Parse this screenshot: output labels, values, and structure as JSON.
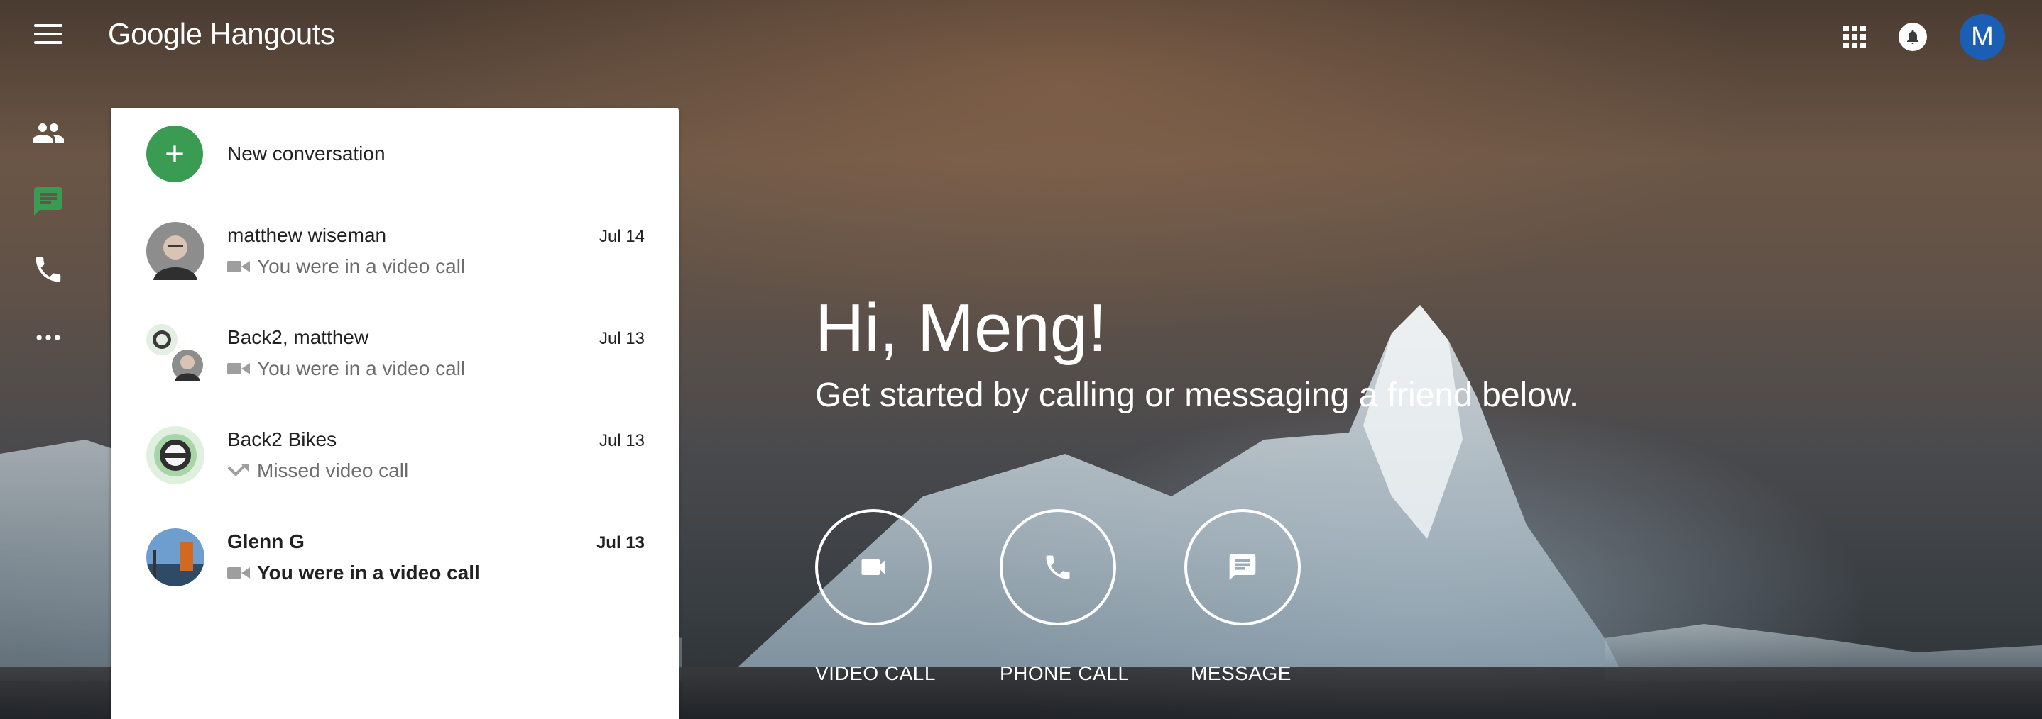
{
  "header": {
    "logo_google": "Google",
    "logo_product": "Hangouts",
    "account_initial": "M",
    "icons": [
      "menu-icon",
      "apps-grid-icon",
      "notifications-bell-icon"
    ]
  },
  "rail": {
    "items": [
      {
        "name": "contacts",
        "icon": "people-icon"
      },
      {
        "name": "conversations",
        "icon": "chat-icon",
        "active": true
      },
      {
        "name": "phone-calls",
        "icon": "phone-icon"
      },
      {
        "name": "more",
        "icon": "more-horiz-icon"
      }
    ]
  },
  "panel": {
    "new_conversation_label": "New conversation",
    "conversations": [
      {
        "name": "matthew wiseman",
        "date": "Jul 14",
        "status": "You were in a video call",
        "status_icon": "video-icon",
        "bold": false
      },
      {
        "name": "Back2, matthew",
        "date": "Jul 13",
        "status": "You were in a video call",
        "status_icon": "video-icon",
        "bold": false
      },
      {
        "name": "Back2 Bikes",
        "date": "Jul 13",
        "status": "Missed video call",
        "status_icon": "missed-call-icon",
        "bold": false
      },
      {
        "name": "Glenn G",
        "date": "Jul 13",
        "status": "You were in a video call",
        "status_icon": "video-icon",
        "bold": true
      }
    ]
  },
  "welcome": {
    "greeting": "Hi, Meng!",
    "subtitle": "Get started by calling or messaging a friend below.",
    "actions": [
      {
        "label": "VIDEO CALL",
        "icon": "videocam-icon"
      },
      {
        "label": "PHONE CALL",
        "icon": "phone-icon"
      },
      {
        "label": "MESSAGE",
        "icon": "message-icon"
      }
    ]
  },
  "colors": {
    "accent_green": "#3a9c52",
    "avatar_blue": "#1b5fb5",
    "panel_bg": "#ffffff",
    "secondary_text": "#6d6d6d"
  }
}
